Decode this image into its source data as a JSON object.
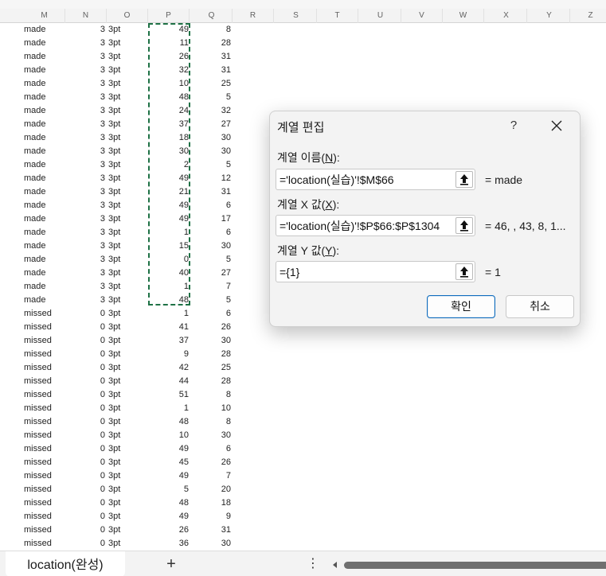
{
  "columns": [
    "M",
    "N",
    "O",
    "P",
    "Q",
    "R",
    "S",
    "T",
    "U",
    "V",
    "W",
    "X",
    "Y",
    "Z"
  ],
  "rows": [
    [
      "made",
      "3",
      "3pt",
      "49",
      "8"
    ],
    [
      "made",
      "3",
      "3pt",
      "11",
      "28"
    ],
    [
      "made",
      "3",
      "3pt",
      "26",
      "31"
    ],
    [
      "made",
      "3",
      "3pt",
      "32",
      "31"
    ],
    [
      "made",
      "3",
      "3pt",
      "10",
      "25"
    ],
    [
      "made",
      "3",
      "3pt",
      "48",
      "5"
    ],
    [
      "made",
      "3",
      "3pt",
      "24",
      "32"
    ],
    [
      "made",
      "3",
      "3pt",
      "37",
      "27"
    ],
    [
      "made",
      "3",
      "3pt",
      "18",
      "30"
    ],
    [
      "made",
      "3",
      "3pt",
      "30",
      "30"
    ],
    [
      "made",
      "3",
      "3pt",
      "2",
      "5"
    ],
    [
      "made",
      "3",
      "3pt",
      "49",
      "12"
    ],
    [
      "made",
      "3",
      "3pt",
      "21",
      "31"
    ],
    [
      "made",
      "3",
      "3pt",
      "49",
      "6"
    ],
    [
      "made",
      "3",
      "3pt",
      "49",
      "17"
    ],
    [
      "made",
      "3",
      "3pt",
      "1",
      "6"
    ],
    [
      "made",
      "3",
      "3pt",
      "15",
      "30"
    ],
    [
      "made",
      "3",
      "3pt",
      "0",
      "5"
    ],
    [
      "made",
      "3",
      "3pt",
      "40",
      "27"
    ],
    [
      "made",
      "3",
      "3pt",
      "1",
      "7"
    ],
    [
      "made",
      "3",
      "3pt",
      "48",
      "5"
    ],
    [
      "missed",
      "0",
      "3pt",
      "1",
      "6"
    ],
    [
      "missed",
      "0",
      "3pt",
      "41",
      "26"
    ],
    [
      "missed",
      "0",
      "3pt",
      "37",
      "30"
    ],
    [
      "missed",
      "0",
      "3pt",
      "9",
      "28"
    ],
    [
      "missed",
      "0",
      "3pt",
      "42",
      "25"
    ],
    [
      "missed",
      "0",
      "3pt",
      "44",
      "28"
    ],
    [
      "missed",
      "0",
      "3pt",
      "51",
      "8"
    ],
    [
      "missed",
      "0",
      "3pt",
      "1",
      "10"
    ],
    [
      "missed",
      "0",
      "3pt",
      "48",
      "8"
    ],
    [
      "missed",
      "0",
      "3pt",
      "10",
      "30"
    ],
    [
      "missed",
      "0",
      "3pt",
      "49",
      "6"
    ],
    [
      "missed",
      "0",
      "3pt",
      "45",
      "26"
    ],
    [
      "missed",
      "0",
      "3pt",
      "49",
      "7"
    ],
    [
      "missed",
      "0",
      "3pt",
      "5",
      "20"
    ],
    [
      "missed",
      "0",
      "3pt",
      "48",
      "18"
    ],
    [
      "missed",
      "0",
      "3pt",
      "49",
      "9"
    ],
    [
      "missed",
      "0",
      "3pt",
      "26",
      "31"
    ],
    [
      "missed",
      "0",
      "3pt",
      "36",
      "30"
    ]
  ],
  "dialog": {
    "title": "계열 편집",
    "help": "?",
    "name_label_pre": "계열 이름(",
    "name_label_key": "N",
    "name_label_post": "):",
    "name_value": "='location(실습)'!$M$66",
    "name_result": "= made",
    "x_label_pre": "계열 X 값(",
    "x_label_key": "X",
    "x_label_post": "):",
    "x_value": "='location(실습)'!$P$66:$P$1304",
    "x_result": "= 46, , 43, 8, 1...",
    "y_label_pre": "계열 Y 값(",
    "y_label_key": "Y",
    "y_label_post": "):",
    "y_value": "={1}",
    "y_result": "= 1",
    "ok": "확인",
    "cancel": "취소"
  },
  "sheet_tab": "location(완성)",
  "add_sheet": "+",
  "more": "⋮",
  "colors": {
    "marquee": "#1e7145",
    "ok_border": "#0f6cbd"
  }
}
